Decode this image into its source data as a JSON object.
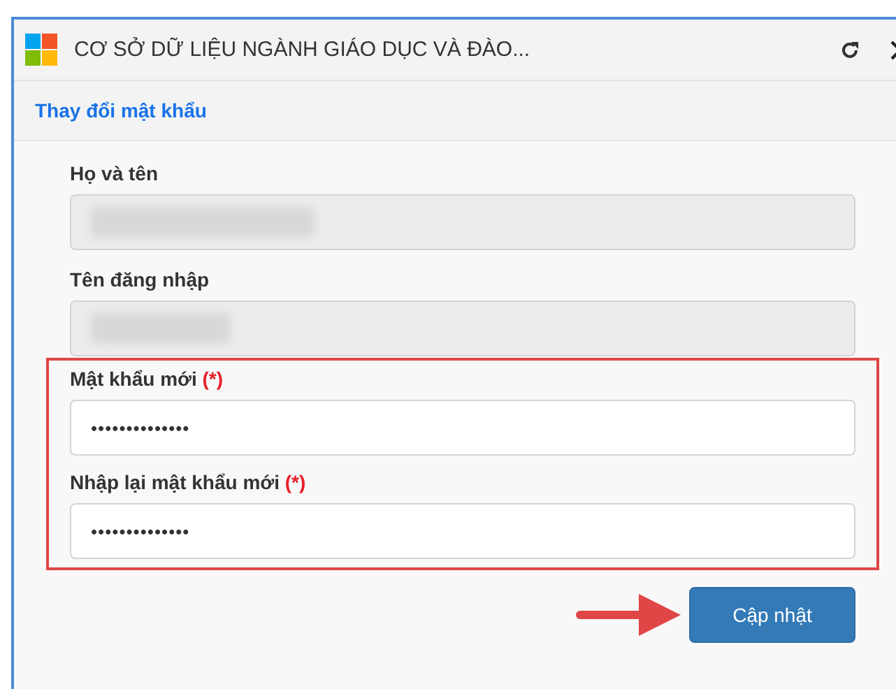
{
  "window": {
    "title": "CƠ SỞ DỮ LIỆU NGÀNH GIÁO DỤC VÀ ĐÀO...",
    "buttons": [
      {
        "kind": "refresh"
      },
      {
        "kind": "close"
      }
    ]
  },
  "dialog": {
    "title": "Thay đổi mật khẩu"
  },
  "fields": [
    {
      "label": "Họ và tên",
      "kind": "blurred",
      "disabled": true,
      "highlighted": false
    },
    {
      "label": "Tên đăng nhập",
      "kind": "blurred",
      "disabled": true,
      "highlighted": false
    },
    {
      "label": "Mật khẩu mới",
      "required_mark": "(*)",
      "kind": "password",
      "value": "••••••••••••••",
      "disabled": false,
      "highlighted": true
    },
    {
      "label": "Nhập lại mật khẩu mới",
      "required_mark": "(*)",
      "kind": "password",
      "value": "••••••••••••••",
      "disabled": false,
      "highlighted": true
    }
  ],
  "submit_button": "Cập nhật"
}
